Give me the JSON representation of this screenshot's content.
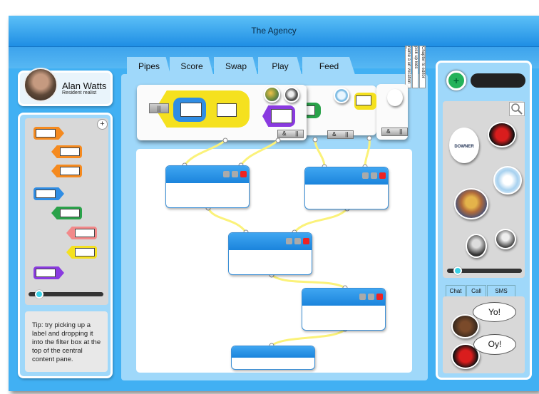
{
  "app": {
    "title": "The Agency"
  },
  "profile": {
    "name": "Alan Watts",
    "role": "Resident realist"
  },
  "left": {
    "add_symbol": "+",
    "labels": [
      {
        "color": "#f58a1f",
        "dir": "right"
      },
      {
        "color": "#f58a1f",
        "dir": "left"
      },
      {
        "color": "#f58a1f",
        "dir": "left"
      },
      {
        "color": "#2f8de4",
        "dir": "right"
      },
      {
        "color": "#2aa24a",
        "dir": "left"
      },
      {
        "color": "#f2898a",
        "dir": "left"
      },
      {
        "color": "#f5e11f",
        "dir": "left"
      },
      {
        "color": "#8a3ae0",
        "dir": "right"
      }
    ],
    "slider_value": 0.1,
    "tip": "Tip: try picking up a label and dropping it into the filter box at the top of the central content pane."
  },
  "tabs": [
    "Pipes",
    "Score",
    "Swap",
    "Play",
    "Feed"
  ],
  "filter": {
    "pause_symbol": "||",
    "amp_symbol": "&",
    "pause_small": "||"
  },
  "notes": [
    "Chapter to editor",
    "pick up kids",
    "name a url vocation fix"
  ],
  "right": {
    "add_symbol": "+",
    "slider_value": 0.1,
    "contact_tabs": [
      "Chat",
      "Call",
      "SMS"
    ],
    "chat": [
      {
        "text": "Yo!"
      },
      {
        "text": "Oy!"
      }
    ],
    "source_labels": [
      "DOWNER"
    ]
  },
  "colors": {
    "frame": "#41b0f3",
    "panel": "#9fd8fa",
    "yellow_pipe": "#fbf27a"
  }
}
